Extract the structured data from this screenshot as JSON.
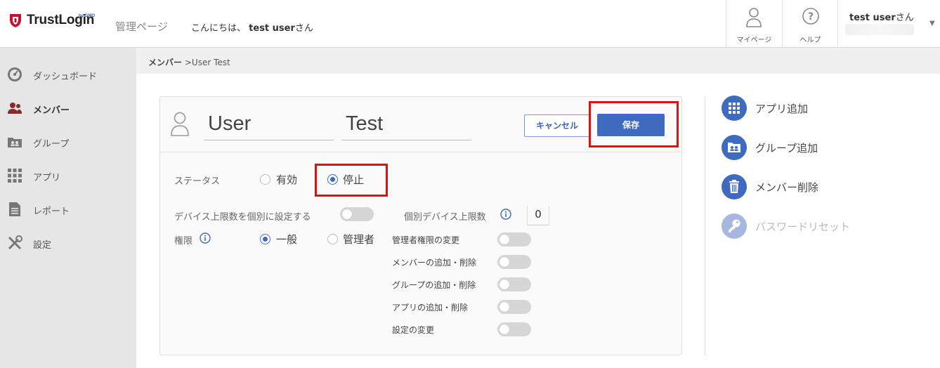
{
  "header": {
    "logo_text": "TrustLogin",
    "logo_sub": "by GMO",
    "admin_label": "管理ページ",
    "greeting_prefix": "こんにちは、",
    "greeting_user": "test user",
    "greeting_suffix": "さん",
    "mypage_label": "マイページ",
    "help_label": "ヘルプ",
    "user_name": "test user",
    "user_suffix": "さん"
  },
  "sidebar": {
    "items": [
      {
        "label": "ダッシュボード",
        "icon": "dashboard-icon"
      },
      {
        "label": "メンバー",
        "icon": "members-icon",
        "active": true
      },
      {
        "label": "グループ",
        "icon": "group-icon"
      },
      {
        "label": "アプリ",
        "icon": "apps-icon"
      },
      {
        "label": "レポート",
        "icon": "report-icon"
      },
      {
        "label": "設定",
        "icon": "settings-icon"
      }
    ]
  },
  "breadcrumb": {
    "root": "メンバー",
    "separator": ">",
    "current": "User Test"
  },
  "form": {
    "first_name": "User",
    "last_name": "Test",
    "cancel_label": "キャンセル",
    "save_label": "保存",
    "status_label": "ステータス",
    "status_options": [
      "有効",
      "停止"
    ],
    "status_selected": "停止",
    "device_limit_label": "デバイス上限数を個別に設定する",
    "device_limit_enabled": false,
    "device_count_label": "個別デバイス上限数",
    "device_count_value": "0",
    "role_label": "権限",
    "role_options": [
      "一般",
      "管理者"
    ],
    "role_selected": "一般",
    "permissions": [
      {
        "label": "管理者権限の変更",
        "enabled": false
      },
      {
        "label": "メンバーの追加・削除",
        "enabled": false
      },
      {
        "label": "グループの追加・削除",
        "enabled": false
      },
      {
        "label": "アプリの追加・削除",
        "enabled": false
      },
      {
        "label": "設定の変更",
        "enabled": false
      }
    ]
  },
  "actions": [
    {
      "label": "アプリ追加",
      "icon": "grid-icon",
      "enabled": true
    },
    {
      "label": "グループ追加",
      "icon": "group-card-icon",
      "enabled": true
    },
    {
      "label": "メンバー削除",
      "icon": "trash-icon",
      "enabled": true
    },
    {
      "label": "パスワードリセット",
      "icon": "key-icon",
      "enabled": false
    }
  ],
  "colors": {
    "accent": "#3e6bc0",
    "highlight": "#e01010",
    "sidebar_bg": "#e6e6e6",
    "logo_red": "#c8102e"
  }
}
